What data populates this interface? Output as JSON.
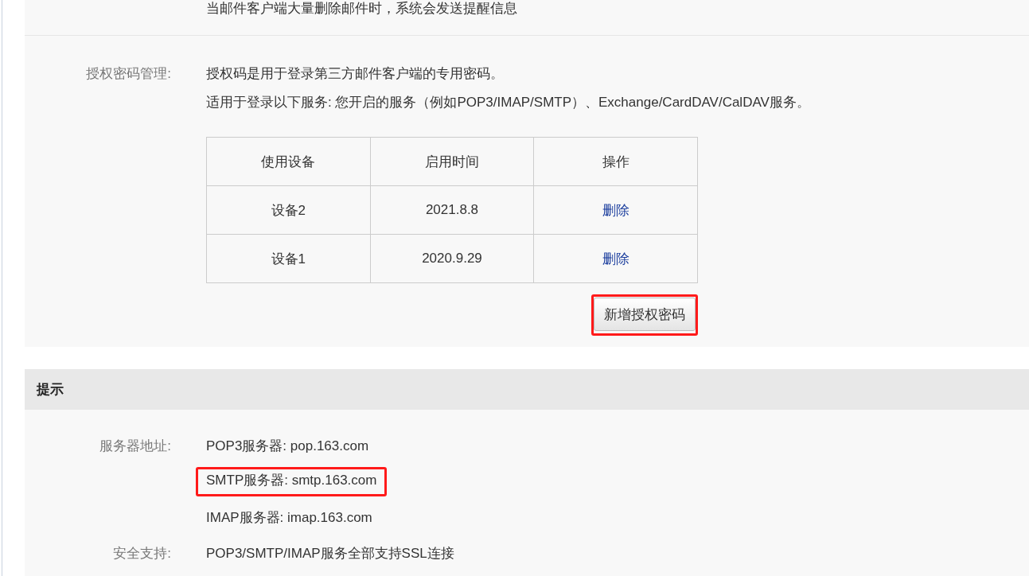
{
  "notice_text": "当邮件客户端大量删除邮件时，系统会发送提醒信息",
  "auth_section": {
    "label": "授权密码管理:",
    "descriptions": [
      "授权码是用于登录第三方邮件客户端的专用密码。",
      "适用于登录以下服务: 您开启的服务（例如POP3/IMAP/SMTP）、Exchange/CardDAV/CalDAV服务。"
    ],
    "table": {
      "columns": [
        {
          "label": "使用设备",
          "kind": "text"
        },
        {
          "label": "启用时间",
          "kind": "text"
        },
        {
          "label": "操作",
          "kind": "link"
        }
      ],
      "rows": [
        [
          "设备2",
          "2021.8.8",
          "删除"
        ],
        [
          "设备1",
          "2020.9.29",
          "删除"
        ]
      ]
    },
    "add_button": {
      "label": "新增授权密码",
      "highlighted": true
    }
  },
  "hint_section": {
    "title": "提示",
    "fields": [
      {
        "label": "服务器地址:",
        "lines": [
          {
            "text": "POP3服务器: pop.163.com",
            "highlighted": false
          },
          {
            "text": "SMTP服务器: smtp.163.com",
            "highlighted": true
          },
          {
            "text": "IMAP服务器: imap.163.com",
            "highlighted": false
          }
        ]
      },
      {
        "label": "安全支持:",
        "lines": [
          {
            "text": "POP3/SMTP/IMAP服务全部支持SSL连接",
            "highlighted": false
          }
        ]
      }
    ]
  }
}
